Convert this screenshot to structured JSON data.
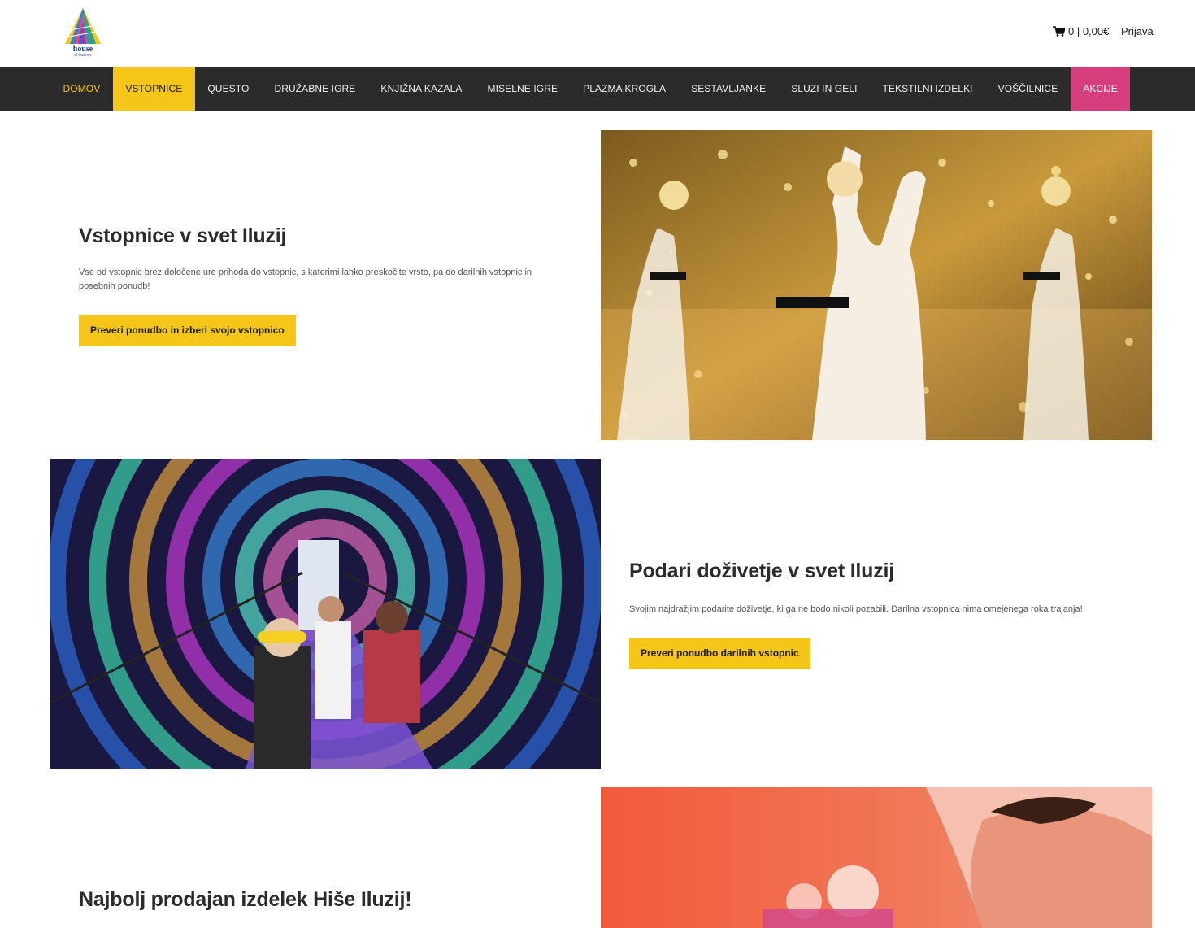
{
  "header": {
    "brand": "house of illusions",
    "cart_summary": "0 | 0,00€",
    "login_label": "Prijava"
  },
  "nav": {
    "items": [
      "DOMOV",
      "VSTOPNICE",
      "QUESTO",
      "DRUŽABNE IGRE",
      "KNJIŽNA KAZALA",
      "MISELNE IGRE",
      "PLAZMA KROGLA",
      "SESTAVLJANKE",
      "SLUZI IN GELI",
      "TEKSTILNI IZDELKI",
      "VOŠČILNICE",
      "AKCIJE"
    ],
    "active": "VSTOPNICE",
    "sale": "AKCIJE"
  },
  "sections": [
    {
      "title": "Vstopnice v svet Iluzij",
      "text": "Vse od vstopnic brez določene ure prihoda do vstopnic, s katerimi lahko preskočite vrsto, pa do darilnih vstopnic in posebnih ponudb!",
      "button": "Preveri ponudbo in izberi svojo vstopnico"
    },
    {
      "title": "Podari doživetje v svet Iluzij",
      "text": "Svojim najdražjim podarite doživetje, ki ga ne bodo nikoli pozabili. Darilna vstopnica nima omejenega roka trajanja!",
      "button": "Preveri ponudbo darilnih vstopnic"
    },
    {
      "title": "Najbolj prodajan izdelek Hiše Iluzij!"
    }
  ],
  "colors": {
    "accent_yellow": "#f5c518",
    "nav_bg": "#2b2b2b",
    "sale_pink": "#d63e7d"
  }
}
